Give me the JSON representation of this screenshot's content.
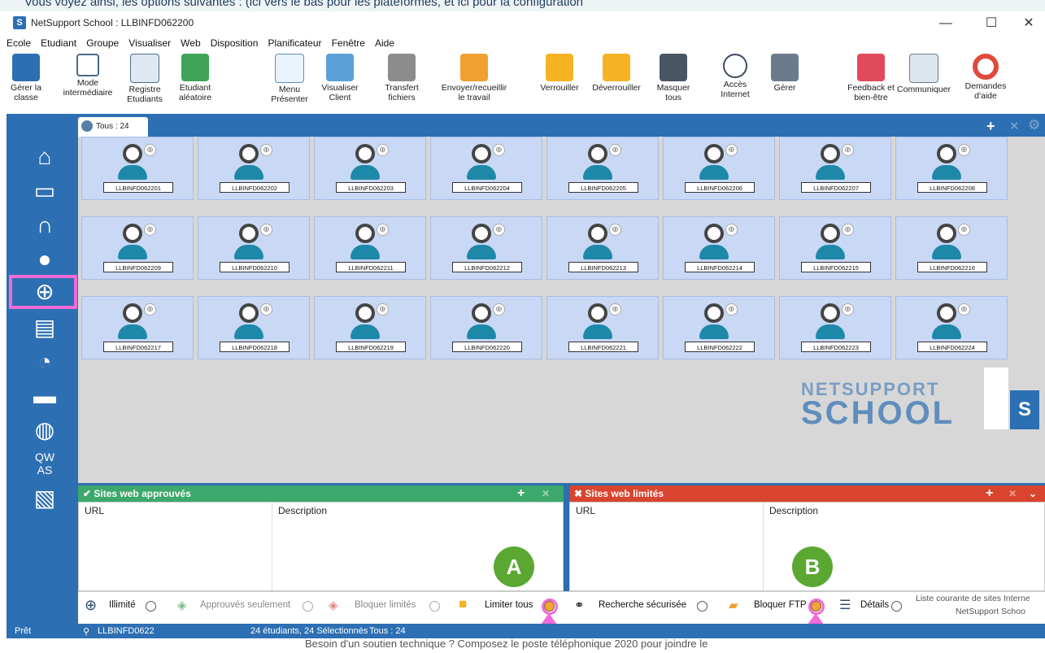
{
  "top_strip_text": "Vous voyez ainsi, les options suivantes : (ici vers le bas pour les plateformes, et ici pour la configuration",
  "window": {
    "title": "NetSupport School : LLBINFD062200",
    "minimize": "—",
    "maximize": "☐",
    "close": "✕"
  },
  "menu": [
    "Ecole",
    "Etudiant",
    "Groupe",
    "Visualiser",
    "Web",
    "Disposition",
    "Planificateur",
    "Fenêtre",
    "Aide"
  ],
  "toolbar": [
    {
      "label": "Gérer la\nclasse",
      "icon": "manage-class-icon"
    },
    {
      "label": "Mode\nintermédiaire",
      "icon": "grid-mode-icon"
    },
    {
      "label": "Registre\nEtudiants",
      "icon": "register-icon"
    },
    {
      "label": "Etudiant\naléatoire",
      "icon": "dice-icon"
    },
    {
      "label": "Menu\nPrésenter",
      "icon": "present-icon"
    },
    {
      "label": "Visualiser\nClient",
      "icon": "view-client-icon"
    },
    {
      "label": "Transfert\nfichiers",
      "icon": "file-transfer-icon"
    },
    {
      "label": "Envoyer/recueillir\nle travail",
      "icon": "briefcase-icon"
    },
    {
      "label": "Verrouiller",
      "icon": "lock-icon"
    },
    {
      "label": "Déverrouiller",
      "icon": "unlock-icon"
    },
    {
      "label": "Masquer\ntous",
      "icon": "monitor-icon"
    },
    {
      "label": "Accès\nInternet",
      "icon": "globe-icon"
    },
    {
      "label": "Gérer",
      "icon": "manage-icon"
    },
    {
      "label": "Feedback et\nbien-être",
      "icon": "feedback-icon"
    },
    {
      "label": "Communiquer",
      "icon": "communicate-icon"
    },
    {
      "label": "Demandes\nd'aide",
      "icon": "help-ring-icon"
    }
  ],
  "tab": {
    "label": "Tous : 24"
  },
  "students": [
    "LLBINFD062201",
    "LLBINFD062202",
    "LLBINFD062203",
    "LLBINFD062204",
    "LLBINFD062205",
    "LLBINFD062206",
    "LLBINFD062207",
    "LLBINFD062208",
    "LLBINFD062209",
    "LLBINFD062210",
    "LLBINFD062211",
    "LLBINFD062212",
    "LLBINFD062213",
    "LLBINFD062214",
    "LLBINFD062215",
    "LLBINFD062216",
    "LLBINFD062217",
    "LLBINFD062218",
    "LLBINFD062219",
    "LLBINFD062220",
    "LLBINFD062221",
    "LLBINFD062222",
    "LLBINFD062223",
    "LLBINFD062224"
  ],
  "logo": {
    "line1": "NETSUPPORT",
    "line2": "SCHOOL",
    "mark": "S"
  },
  "approved_panel": {
    "title": "Sites web approuvés",
    "col_url": "URL",
    "col_desc": "Description",
    "color": "#3ca86b"
  },
  "limited_panel": {
    "title": "Sites web limités",
    "col_url": "URL",
    "col_desc": "Description",
    "color": "#d9442e"
  },
  "bottom": {
    "illimite": "Illimité",
    "approuves": "Approuvés seulement",
    "bloquer_limites": "Bloquer limités",
    "limiter_tous": "Limiter tous",
    "recherche": "Recherche sécurisée",
    "bloquer_ftp": "Bloquer FTP",
    "details": "Détails",
    "liste_1": "Liste courante de sites Interne",
    "liste_2": "NetSupport Schoo"
  },
  "status": {
    "ready": "Prêt",
    "machine": "LLBINFD0622",
    "count": "24 étudiants, 24 Sélectionnés",
    "tous": "Tous : 24"
  },
  "below_text": "Besoin d'un soutien technique ? Composez le poste téléphonique 2020 pour joindre le",
  "annotations": {
    "a": "A",
    "b": "B",
    "accent": "#f06ad8",
    "badge_color": "#5aa832"
  }
}
